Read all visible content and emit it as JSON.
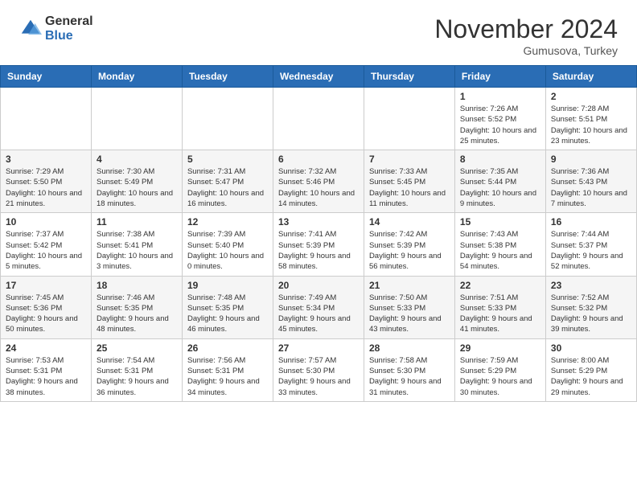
{
  "header": {
    "logo_general": "General",
    "logo_blue": "Blue",
    "month_title": "November 2024",
    "location": "Gumusova, Turkey"
  },
  "calendar": {
    "days_of_week": [
      "Sunday",
      "Monday",
      "Tuesday",
      "Wednesday",
      "Thursday",
      "Friday",
      "Saturday"
    ],
    "weeks": [
      {
        "row_style": "row-white",
        "days": [
          {
            "num": "",
            "info": ""
          },
          {
            "num": "",
            "info": ""
          },
          {
            "num": "",
            "info": ""
          },
          {
            "num": "",
            "info": ""
          },
          {
            "num": "",
            "info": ""
          },
          {
            "num": "1",
            "info": "Sunrise: 7:26 AM\nSunset: 5:52 PM\nDaylight: 10 hours and 25 minutes."
          },
          {
            "num": "2",
            "info": "Sunrise: 7:28 AM\nSunset: 5:51 PM\nDaylight: 10 hours and 23 minutes."
          }
        ]
      },
      {
        "row_style": "row-gray",
        "days": [
          {
            "num": "3",
            "info": "Sunrise: 7:29 AM\nSunset: 5:50 PM\nDaylight: 10 hours and 21 minutes."
          },
          {
            "num": "4",
            "info": "Sunrise: 7:30 AM\nSunset: 5:49 PM\nDaylight: 10 hours and 18 minutes."
          },
          {
            "num": "5",
            "info": "Sunrise: 7:31 AM\nSunset: 5:47 PM\nDaylight: 10 hours and 16 minutes."
          },
          {
            "num": "6",
            "info": "Sunrise: 7:32 AM\nSunset: 5:46 PM\nDaylight: 10 hours and 14 minutes."
          },
          {
            "num": "7",
            "info": "Sunrise: 7:33 AM\nSunset: 5:45 PM\nDaylight: 10 hours and 11 minutes."
          },
          {
            "num": "8",
            "info": "Sunrise: 7:35 AM\nSunset: 5:44 PM\nDaylight: 10 hours and 9 minutes."
          },
          {
            "num": "9",
            "info": "Sunrise: 7:36 AM\nSunset: 5:43 PM\nDaylight: 10 hours and 7 minutes."
          }
        ]
      },
      {
        "row_style": "row-white",
        "days": [
          {
            "num": "10",
            "info": "Sunrise: 7:37 AM\nSunset: 5:42 PM\nDaylight: 10 hours and 5 minutes."
          },
          {
            "num": "11",
            "info": "Sunrise: 7:38 AM\nSunset: 5:41 PM\nDaylight: 10 hours and 3 minutes."
          },
          {
            "num": "12",
            "info": "Sunrise: 7:39 AM\nSunset: 5:40 PM\nDaylight: 10 hours and 0 minutes."
          },
          {
            "num": "13",
            "info": "Sunrise: 7:41 AM\nSunset: 5:39 PM\nDaylight: 9 hours and 58 minutes."
          },
          {
            "num": "14",
            "info": "Sunrise: 7:42 AM\nSunset: 5:39 PM\nDaylight: 9 hours and 56 minutes."
          },
          {
            "num": "15",
            "info": "Sunrise: 7:43 AM\nSunset: 5:38 PM\nDaylight: 9 hours and 54 minutes."
          },
          {
            "num": "16",
            "info": "Sunrise: 7:44 AM\nSunset: 5:37 PM\nDaylight: 9 hours and 52 minutes."
          }
        ]
      },
      {
        "row_style": "row-gray",
        "days": [
          {
            "num": "17",
            "info": "Sunrise: 7:45 AM\nSunset: 5:36 PM\nDaylight: 9 hours and 50 minutes."
          },
          {
            "num": "18",
            "info": "Sunrise: 7:46 AM\nSunset: 5:35 PM\nDaylight: 9 hours and 48 minutes."
          },
          {
            "num": "19",
            "info": "Sunrise: 7:48 AM\nSunset: 5:35 PM\nDaylight: 9 hours and 46 minutes."
          },
          {
            "num": "20",
            "info": "Sunrise: 7:49 AM\nSunset: 5:34 PM\nDaylight: 9 hours and 45 minutes."
          },
          {
            "num": "21",
            "info": "Sunrise: 7:50 AM\nSunset: 5:33 PM\nDaylight: 9 hours and 43 minutes."
          },
          {
            "num": "22",
            "info": "Sunrise: 7:51 AM\nSunset: 5:33 PM\nDaylight: 9 hours and 41 minutes."
          },
          {
            "num": "23",
            "info": "Sunrise: 7:52 AM\nSunset: 5:32 PM\nDaylight: 9 hours and 39 minutes."
          }
        ]
      },
      {
        "row_style": "row-white",
        "days": [
          {
            "num": "24",
            "info": "Sunrise: 7:53 AM\nSunset: 5:31 PM\nDaylight: 9 hours and 38 minutes."
          },
          {
            "num": "25",
            "info": "Sunrise: 7:54 AM\nSunset: 5:31 PM\nDaylight: 9 hours and 36 minutes."
          },
          {
            "num": "26",
            "info": "Sunrise: 7:56 AM\nSunset: 5:31 PM\nDaylight: 9 hours and 34 minutes."
          },
          {
            "num": "27",
            "info": "Sunrise: 7:57 AM\nSunset: 5:30 PM\nDaylight: 9 hours and 33 minutes."
          },
          {
            "num": "28",
            "info": "Sunrise: 7:58 AM\nSunset: 5:30 PM\nDaylight: 9 hours and 31 minutes."
          },
          {
            "num": "29",
            "info": "Sunrise: 7:59 AM\nSunset: 5:29 PM\nDaylight: 9 hours and 30 minutes."
          },
          {
            "num": "30",
            "info": "Sunrise: 8:00 AM\nSunset: 5:29 PM\nDaylight: 9 hours and 29 minutes."
          }
        ]
      }
    ]
  }
}
